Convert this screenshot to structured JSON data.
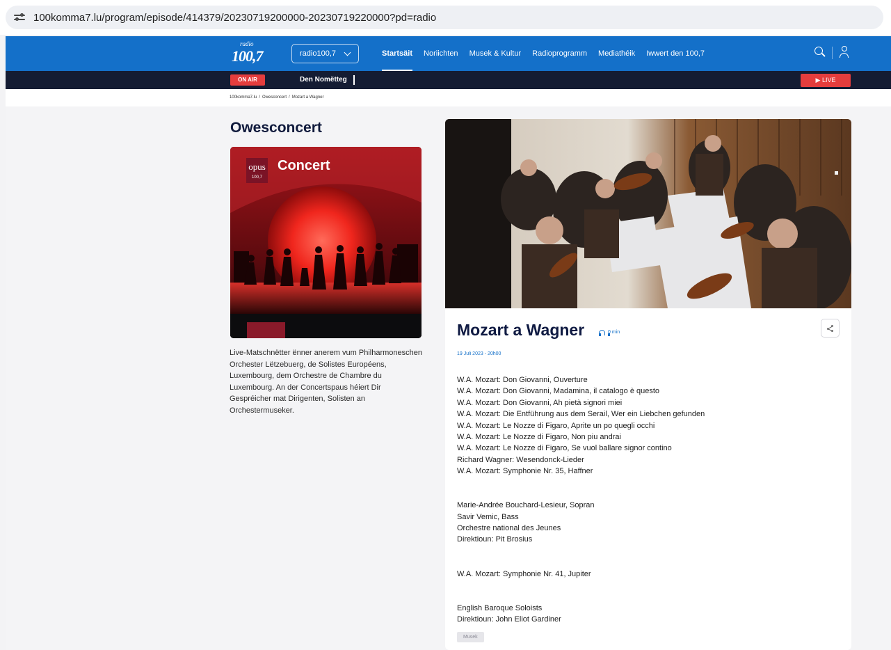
{
  "browser": {
    "url": "100komma7.lu/program/episode/414379/20230719200000-20230719220000?pd=radio"
  },
  "header": {
    "logo_small": "radio",
    "logo_big": "100,7",
    "station_select": "radio100,7",
    "nav": [
      "Startsäit",
      "Noriichten",
      "Musek & Kultur",
      "Radioprogramm",
      "Mediathéik",
      "Iwwert den 100,7"
    ],
    "active_nav": "Startsäit"
  },
  "onair": {
    "badge": "ON AIR",
    "now_playing": "Den Nomëtteg",
    "live_label": "▶ LIVE"
  },
  "breadcrumb": [
    "100komma7.lu",
    "Owesconcert",
    "Mozart a Wagner"
  ],
  "program": {
    "title": "Owesconcert",
    "art_brand": "opus",
    "art_brand_sub": "100,7",
    "art_title": "Concert",
    "description": "Live-Matschnëtter ënner anerem vum Philharmoneschen Orchester Lëtzebuerg, de Solistes Européens, Luxembourg, dem Orchestre de Chambre du Luxembourg. An der Concertspaus héiert Dir Gespréicher mat Dirigenten, Solisten an Orchestermuseker."
  },
  "episode": {
    "title": "Mozart a Wagner",
    "duration": "0 min",
    "date": "19 Juli 2023 - 20h00",
    "tracklist_1": [
      "W.A. Mozart: Don Giovanni, Ouverture",
      "W.A. Mozart: Don Giovanni, Madamina, il catalogo è questo",
      "W.A. Mozart: Don Giovanni, Ah pietà signori miei",
      "W.A. Mozart: Die Entführung aus dem Serail, Wer ein Liebchen gefunden",
      "W.A. Mozart: Le Nozze di Figaro, Aprite un po quegli occhi",
      "W.A. Mozart: Le Nozze di Figaro, Non piu andrai",
      "W.A. Mozart: Le Nozze di Figaro, Se vuol ballare signor contino",
      "Richard Wagner: Wesendonck-Lieder",
      "W.A. Mozart: Symphonie Nr. 35, Haffner"
    ],
    "performers_1": [
      "Marie-Andrée Bouchard-Lesieur, Sopran",
      "Savir Vemic, Bass",
      "Orchestre national des Jeunes",
      "Direktioun: Pit Brosius"
    ],
    "tracklist_2": [
      "W.A. Mozart: Symphonie Nr. 41, Jupiter"
    ],
    "performers_2": [
      "English Baroque Soloists",
      "Direktioun: John Eliot Gardiner"
    ],
    "tag": "Musek"
  },
  "colors": {
    "brand_blue": "#1470c9",
    "dark_bar": "#141c33",
    "live_red": "#e43d3d",
    "title_navy": "#0f1a42"
  }
}
